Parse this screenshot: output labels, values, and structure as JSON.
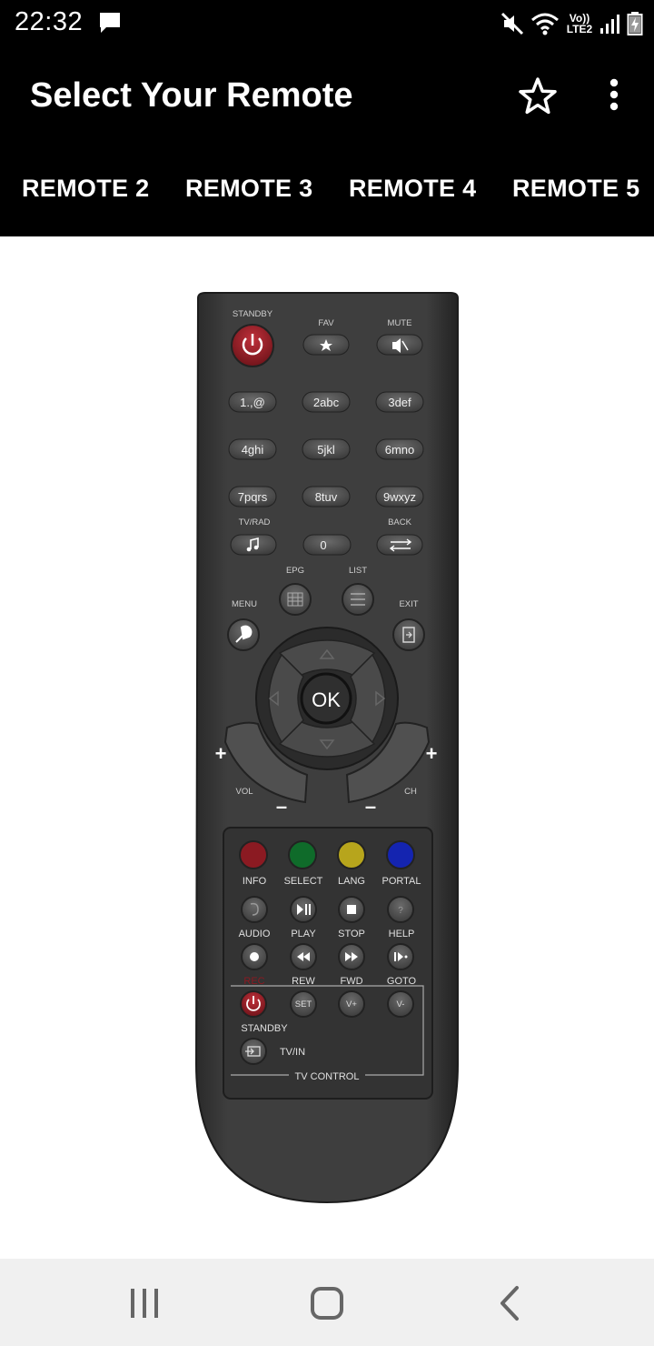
{
  "status_bar": {
    "time": "22:32",
    "lte_top": "Vo))",
    "lte_bottom": "LTE2",
    "icons": [
      "chat-icon",
      "mute-icon",
      "wifi-icon",
      "signal-icon",
      "battery-charging-icon"
    ]
  },
  "app_bar": {
    "title": "Select Your Remote",
    "favorite_icon": "star-outline-icon",
    "more_icon": "more-vert-icon"
  },
  "tabs": [
    {
      "label": "REMOTE 2"
    },
    {
      "label": "REMOTE 3"
    },
    {
      "label": "REMOTE 4"
    },
    {
      "label": "REMOTE 5"
    }
  ],
  "remote": {
    "top_labels": {
      "standby": "STANDBY",
      "fav": "FAV",
      "mute": "MUTE"
    },
    "digits": [
      "1.,@",
      "2abc",
      "3def",
      "4ghi",
      "5jkl",
      "6mno",
      "7pqrs",
      "8tuv",
      "9wxyz",
      "0"
    ],
    "labels": {
      "tv_rad": "TV/RAD",
      "back": "BACK",
      "epg": "EPG",
      "list": "LIST",
      "menu": "MENU",
      "exit": "EXIT",
      "ok": "OK",
      "vol": "VOL",
      "ch": "CH",
      "plus": "+",
      "minus": "–"
    },
    "color_row": [
      "INFO",
      "SELECT",
      "LANG",
      "PORTAL"
    ],
    "media_row1": [
      "AUDIO",
      "PLAY",
      "STOP",
      "HELP"
    ],
    "media_row2": [
      "REC",
      "REW",
      "FWD",
      "GOTO"
    ],
    "tv_control": {
      "set": "SET",
      "v_plus": "V+",
      "v_minus": "V-",
      "standby": "STANDBY",
      "tv_in": "TV/IN",
      "title": "TV CONTROL"
    },
    "colors": {
      "body": "#3a3a3a",
      "red": "#8b1a22",
      "green": "#0f6b2a",
      "yellow": "#b7a51c",
      "blue": "#1424b0"
    }
  },
  "nav_bar": {
    "icons": [
      "recent-apps-icon",
      "home-icon",
      "back-icon"
    ]
  }
}
